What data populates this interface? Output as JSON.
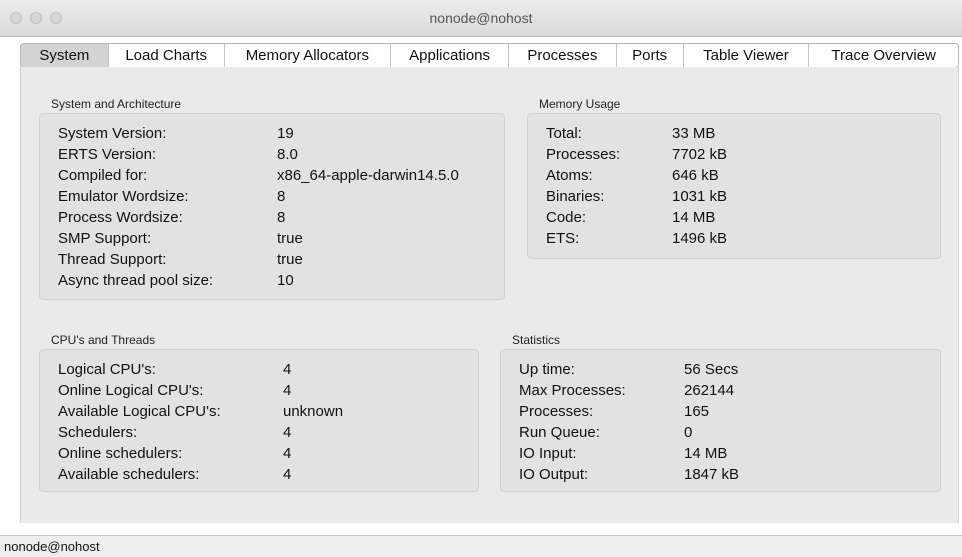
{
  "window": {
    "title": "nonode@nohost"
  },
  "tabs": [
    {
      "label": "System"
    },
    {
      "label": "Load Charts"
    },
    {
      "label": "Memory Allocators"
    },
    {
      "label": "Applications"
    },
    {
      "label": "Processes"
    },
    {
      "label": "Ports"
    },
    {
      "label": "Table Viewer"
    },
    {
      "label": "Trace Overview"
    }
  ],
  "system_arch": {
    "title": "System and Architecture",
    "rows": [
      {
        "label": "System Version:",
        "value": "19"
      },
      {
        "label": "ERTS Version:",
        "value": "8.0"
      },
      {
        "label": "Compiled for:",
        "value": "x86_64-apple-darwin14.5.0"
      },
      {
        "label": "Emulator Wordsize:",
        "value": "8"
      },
      {
        "label": "Process Wordsize:",
        "value": "8"
      },
      {
        "label": "SMP Support:",
        "value": "true"
      },
      {
        "label": "Thread Support:",
        "value": "true"
      },
      {
        "label": "Async thread pool size:",
        "value": "10"
      }
    ]
  },
  "memory_usage": {
    "title": "Memory Usage",
    "rows": [
      {
        "label": "Total:",
        "value": "33 MB"
      },
      {
        "label": "Processes:",
        "value": "7702 kB"
      },
      {
        "label": "Atoms:",
        "value": "646 kB"
      },
      {
        "label": "Binaries:",
        "value": "1031 kB"
      },
      {
        "label": "Code:",
        "value": "14 MB"
      },
      {
        "label": "ETS:",
        "value": "1496 kB"
      }
    ]
  },
  "cpu_threads": {
    "title": "CPU's and Threads",
    "rows": [
      {
        "label": "Logical CPU's:",
        "value": "4"
      },
      {
        "label": "Online Logical CPU's:",
        "value": "4"
      },
      {
        "label": "Available Logical CPU's:",
        "value": "unknown"
      },
      {
        "label": "Schedulers:",
        "value": "4"
      },
      {
        "label": "Online schedulers:",
        "value": "4"
      },
      {
        "label": "Available schedulers:",
        "value": "4"
      }
    ]
  },
  "statistics": {
    "title": "Statistics",
    "rows": [
      {
        "label": "Up time:",
        "value": "56 Secs"
      },
      {
        "label": "Max Processes:",
        "value": "262144"
      },
      {
        "label": "Processes:",
        "value": "165"
      },
      {
        "label": "Run Queue:",
        "value": "0"
      },
      {
        "label": "IO Input:",
        "value": "14 MB"
      },
      {
        "label": "IO Output:",
        "value": "1847 kB"
      }
    ]
  },
  "statusbar": {
    "text": "nonode@nohost"
  }
}
